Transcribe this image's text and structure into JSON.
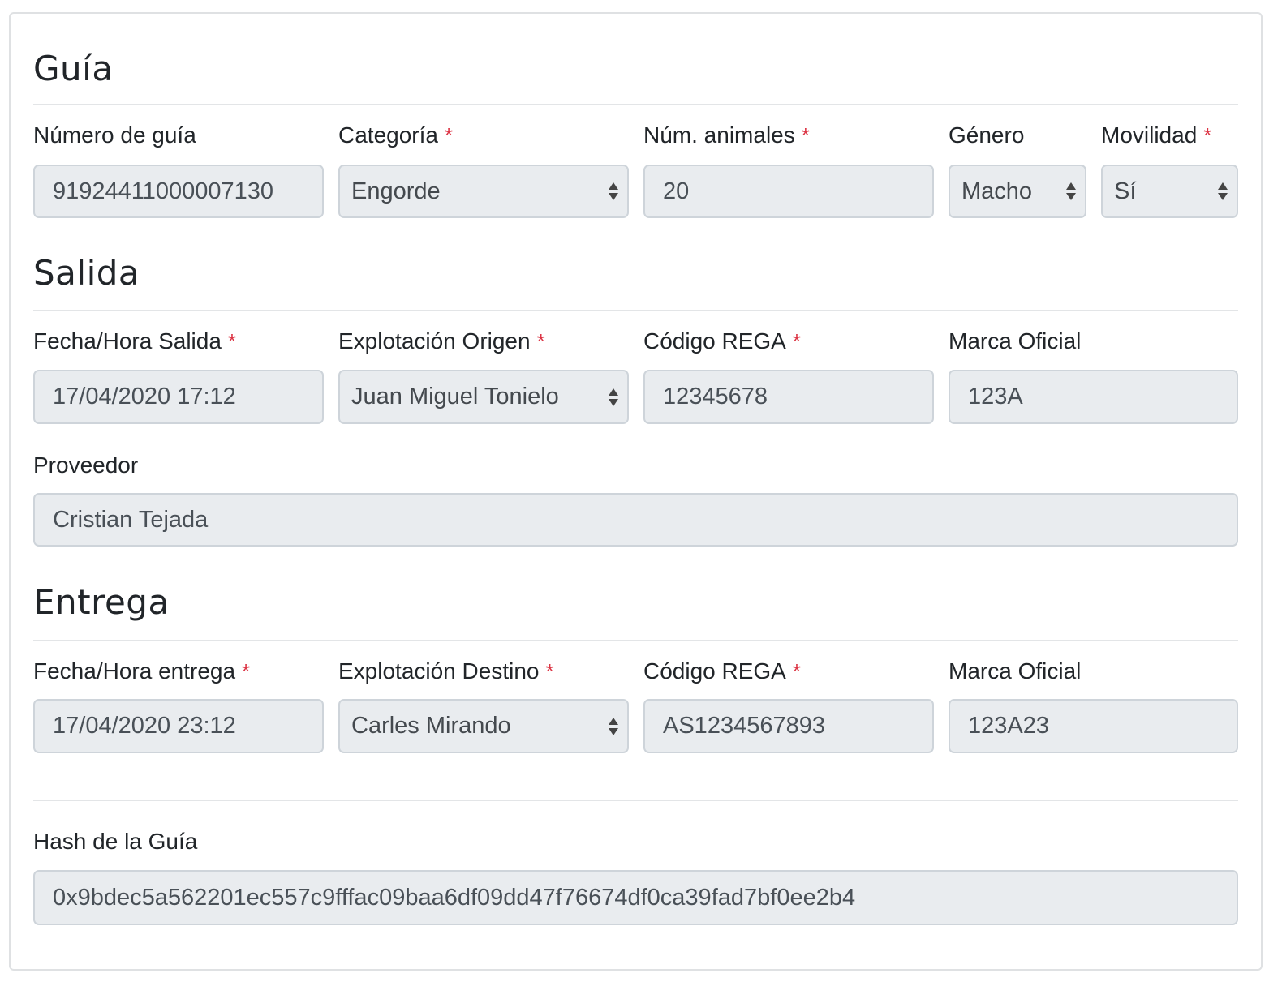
{
  "guia": {
    "title": "Guía",
    "numero": {
      "label": "Número de guía",
      "value": "91924411000007130"
    },
    "categoria": {
      "label": "Categoría",
      "required": "*",
      "value": "Engorde"
    },
    "num_animales": {
      "label": "Núm. animales",
      "required": "*",
      "value": "20"
    },
    "genero": {
      "label": "Género",
      "value": "Macho"
    },
    "movilidad": {
      "label": "Movilidad",
      "required": "*",
      "value": "Sí"
    }
  },
  "salida": {
    "title": "Salida",
    "fecha": {
      "label": "Fecha/Hora Salida",
      "required": "*",
      "value": "17/04/2020 17:12"
    },
    "explotacion": {
      "label": "Explotación Origen",
      "required": "*",
      "value": "Juan Miguel Tonielo"
    },
    "codigo_rega": {
      "label": "Código REGA",
      "required": "*",
      "value": "12345678"
    },
    "marca": {
      "label": "Marca Oficial",
      "value": "123A"
    },
    "proveedor": {
      "label": "Proveedor",
      "value": "Cristian Tejada"
    }
  },
  "entrega": {
    "title": "Entrega",
    "fecha": {
      "label": "Fecha/Hora entrega",
      "required": "*",
      "value": "17/04/2020 23:12"
    },
    "explotacion": {
      "label": "Explotación Destino",
      "required": "*",
      "value": "Carles Mirando"
    },
    "codigo_rega": {
      "label": "Código REGA",
      "required": "*",
      "value": "AS1234567893"
    },
    "marca": {
      "label": "Marca Oficial",
      "value": "123A23"
    }
  },
  "hash": {
    "label": "Hash de la Guía",
    "value": "0x9bdec5a562201ec557c9fffac09baa6df09dd47f76674df0ca39fad7bf0ee2b4"
  },
  "colors": {
    "required": "#dc3545",
    "field_bg": "#e9ecef",
    "field_border": "#ced4da"
  }
}
